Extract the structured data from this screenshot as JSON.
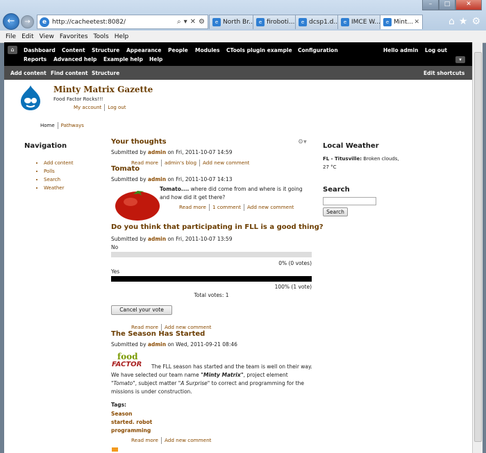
{
  "browser": {
    "url": "http://cacheetest:8082/",
    "tabs": [
      {
        "label": "North Br..."
      },
      {
        "label": "firoboti..."
      },
      {
        "label": "dcsp1.d..."
      },
      {
        "label": "IMCE W..."
      },
      {
        "label": "Mint...",
        "active": true
      }
    ],
    "menu": [
      "File",
      "Edit",
      "View",
      "Favorites",
      "Tools",
      "Help"
    ]
  },
  "toolbar": {
    "row1": [
      "Dashboard",
      "Content",
      "Structure",
      "Appearance",
      "People",
      "Modules",
      "CTools plugin example",
      "Configuration"
    ],
    "row2": [
      "Reports",
      "Advanced help",
      "Example help",
      "Help"
    ],
    "hello": "Hello admin",
    "logout": "Log out",
    "shortcuts": [
      "Add content",
      "Find content",
      "Structure"
    ],
    "edit_shortcuts": "Edit shortcuts"
  },
  "site": {
    "name": "Minty Matrix Gazette",
    "slogan": "Food Factor Rocks!!!",
    "secondary": [
      "My account",
      "Log out"
    ],
    "primary": [
      "Home",
      "Pathways"
    ]
  },
  "navigation": {
    "title": "Navigation",
    "items": [
      "Add content",
      "Polls",
      "Search",
      "Weather"
    ]
  },
  "nodes": {
    "thoughts": {
      "title": "Your thoughts",
      "submitted_prefix": "Submitted by",
      "author": "admin",
      "date": "on Fri, 2011-10-07 14:59",
      "links": [
        "Read more",
        "admin's blog",
        "Add new comment"
      ]
    },
    "tomato": {
      "title": "Tomato",
      "submitted_prefix": "Submitted by",
      "author": "admin",
      "date": "on Fri, 2011-10-07 14:13",
      "lead": "Tomato....",
      "body": " where did come from and where is it going and how did it get there?",
      "links": [
        "Read more",
        "1 comment",
        "Add new comment"
      ]
    },
    "poll": {
      "title": "Do you think that participating in FLL is a good thing?",
      "submitted_prefix": "Submitted by",
      "author": "admin",
      "date": "on Fri, 2011-10-07 13:59",
      "choices": [
        {
          "label": "No",
          "percent_text": "0% (0 votes)",
          "fraction": 0
        },
        {
          "label": "Yes",
          "percent_text": "100% (1 vote)",
          "fraction": 1
        }
      ],
      "total": "Total votes: 1",
      "cancel": "Cancel your vote",
      "links": [
        "Read more",
        "Add new comment"
      ]
    },
    "season": {
      "title": "The Season Has Started",
      "submitted_prefix": "Submitted by",
      "author": "admin",
      "date": "on Wed, 2011-09-21 08:46",
      "logo_top": "food",
      "logo_bottom": "FACTOR",
      "p1": "The FLL season has started and the team is well on their way. We have selected our team name ",
      "team": "\"Minty Matrix\"",
      "p2": ", project element ",
      "element": "\"Tomato\"",
      "p3": ", subject matter ",
      "subject": "\"A Surprise\"",
      "p4": "  to correct and programming for the missions is under construction.",
      "tags_label": "Tags:",
      "tags": [
        "Season",
        "started. robot",
        "programming"
      ],
      "links": [
        "Read more",
        "Add new comment"
      ]
    }
  },
  "sidebar": {
    "weather_title": "Local Weather",
    "weather_place": "FL - Titusville:",
    "weather_desc": " Broken clouds,",
    "weather_temp": "27 °C",
    "search_title": "Search",
    "search_button": "Search"
  },
  "colors": {
    "link": "#8a4b00",
    "title": "#6b3d00",
    "toolbar": "#000000"
  }
}
